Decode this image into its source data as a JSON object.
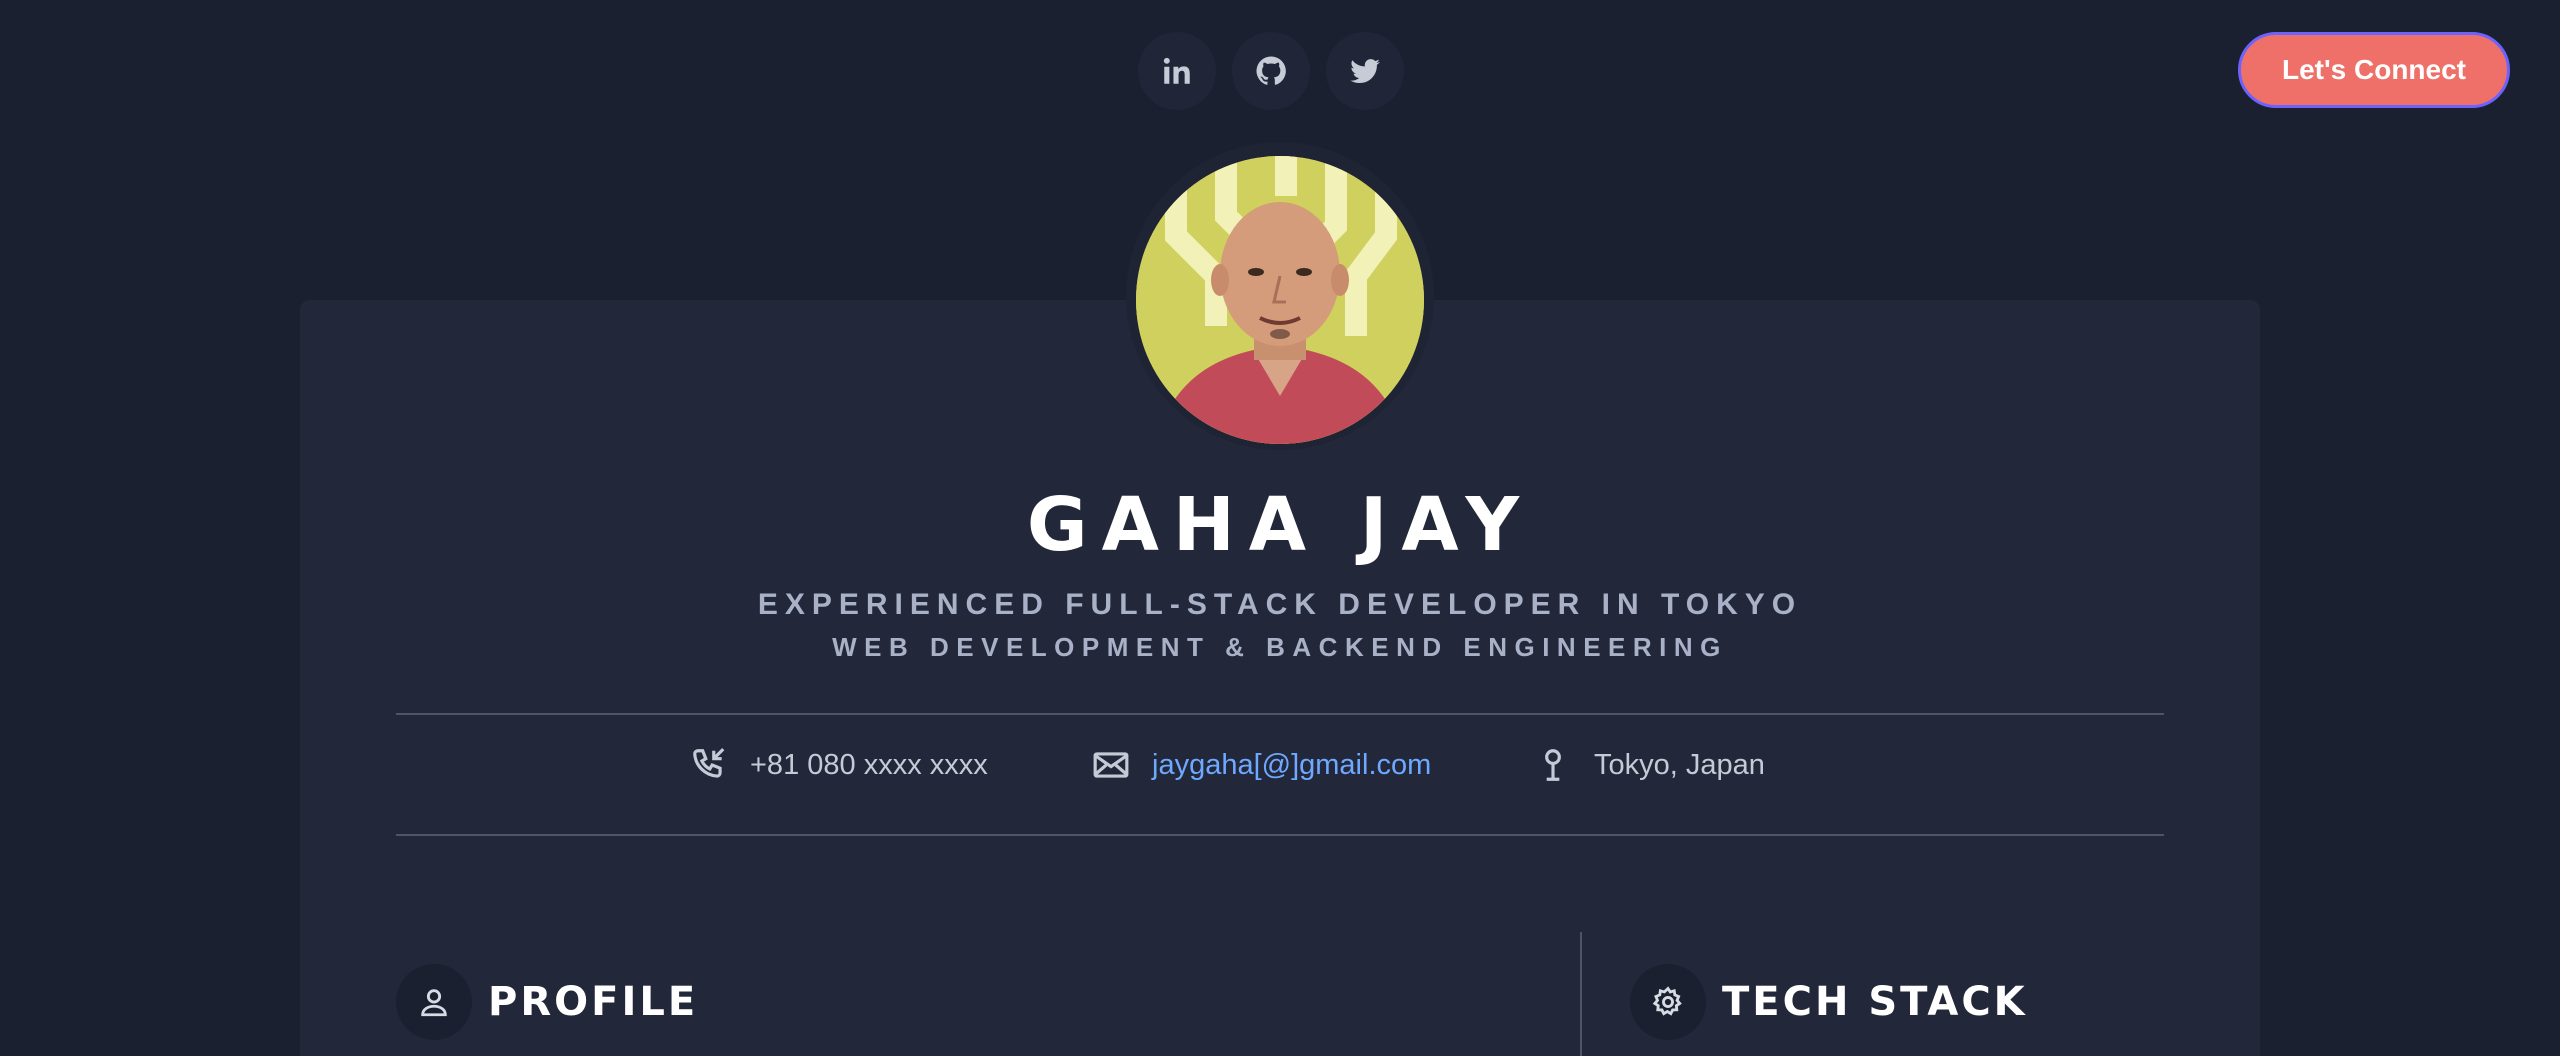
{
  "social": {
    "items": [
      {
        "icon": "linkedin-icon"
      },
      {
        "icon": "github-icon"
      },
      {
        "icon": "twitter-icon"
      }
    ]
  },
  "cta": {
    "label": "Let's Connect"
  },
  "profile_header": {
    "name": "GAHA JAY",
    "subtitle_line1": "EXPERIENCED FULL-STACK DEVELOPER IN TOKYO",
    "subtitle_line2": "WEB DEVELOPMENT & BACKEND ENGINEERING"
  },
  "contact": {
    "phone": "+81 080 xxxx xxxx",
    "email": "jaygaha[@]gmail.com",
    "location": "Tokyo, Japan"
  },
  "sections": {
    "profile_label": "PROFILE",
    "tech_stack_label": "TECH STACK"
  },
  "colors": {
    "background": "#1b2030",
    "card": "#222839",
    "accent": "#ee7068",
    "link": "#6ea8ff"
  }
}
